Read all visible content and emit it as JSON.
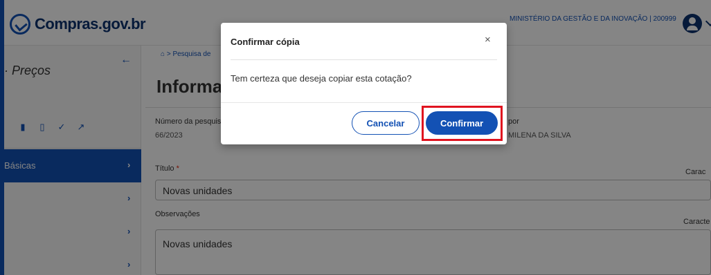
{
  "header": {
    "logo_text": "Compras.gov.br",
    "org": "MINISTÉRIO DA GESTÃO E DA INOVAÇÃO | 200999"
  },
  "sidebar": {
    "title": "Preços",
    "back_icon": "arrow-left-icon",
    "actions": [
      "download-icon",
      "file-icon",
      "check-icon",
      "external-link-icon"
    ],
    "items": [
      {
        "label": "Básicas",
        "active": true
      },
      {
        "label": "",
        "active": false
      },
      {
        "label": "",
        "active": false
      },
      {
        "label": "",
        "active": false
      }
    ]
  },
  "breadcrumb": {
    "home_icon": "home-icon",
    "separator": ">",
    "current": "Pesquisa de"
  },
  "main": {
    "title": "Informações",
    "numero_label": "Número da pesquisa",
    "numero_value": "66/2023",
    "por_label": "por",
    "por_value": "MILENA DA SILVA",
    "titulo_label": "Título",
    "titulo_value": "Novas unidades",
    "caract_label": "Carac",
    "obs_label": "Observações",
    "obs_value": "Novas unidades",
    "caract2_label": "Caracte"
  },
  "dialog": {
    "title": "Confirmar cópia",
    "message": "Tem certeza que deseja copiar esta cotação?",
    "cancel_label": "Cancelar",
    "confirm_label": "Confirmar",
    "close_glyph": "×"
  },
  "colors": {
    "primary": "#1351b4",
    "highlight": "#e0131f"
  }
}
